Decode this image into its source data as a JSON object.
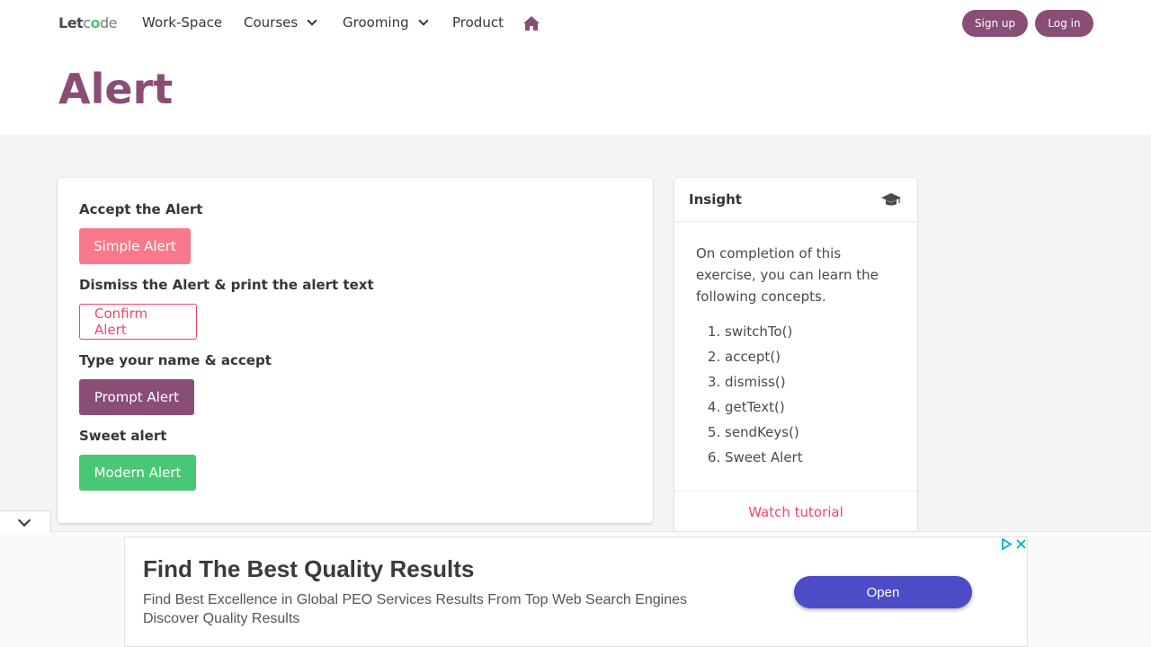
{
  "nav": {
    "logo_prefix": "Let",
    "logo_o": "o",
    "logo_c": "c",
    "logo_suffix": "de",
    "items": [
      {
        "label": "Work-Space"
      },
      {
        "label": "Courses"
      },
      {
        "label": "Grooming"
      },
      {
        "label": "Product"
      }
    ],
    "home_icon": "home-icon",
    "signup_label": "Sign up",
    "login_label": "Log in"
  },
  "page": {
    "title": "Alert"
  },
  "exercises": [
    {
      "label": "Accept the Alert",
      "button": "Simple Alert"
    },
    {
      "label": "Dismiss the Alert & print the alert text",
      "button": "Confirm Alert"
    },
    {
      "label": "Type your name & accept",
      "button": "Prompt Alert"
    },
    {
      "label": "Sweet alert",
      "button": "Modern Alert"
    }
  ],
  "insight": {
    "title": "Insight",
    "icon": "graduation-cap-icon",
    "intro": "On completion of this exercise, you can learn the following concepts.",
    "concepts": [
      "switchTo()",
      "accept()",
      "dismiss()",
      "getText()",
      "sendKeys()",
      "Sweet Alert"
    ],
    "watch_label": "Watch tutorial"
  },
  "ad": {
    "title": "Find The Best Quality Results",
    "line1": "Find Best Excellence in Global PEO Services Results From Top Web Search Engines",
    "line2": "Discover Quality Results",
    "open_label": "Open"
  },
  "colors": {
    "brand": "#8a4d76",
    "danger": "#f14668",
    "danger_light": "#f8798b",
    "success": "#48c774",
    "ad_button": "#4c4cc6"
  }
}
